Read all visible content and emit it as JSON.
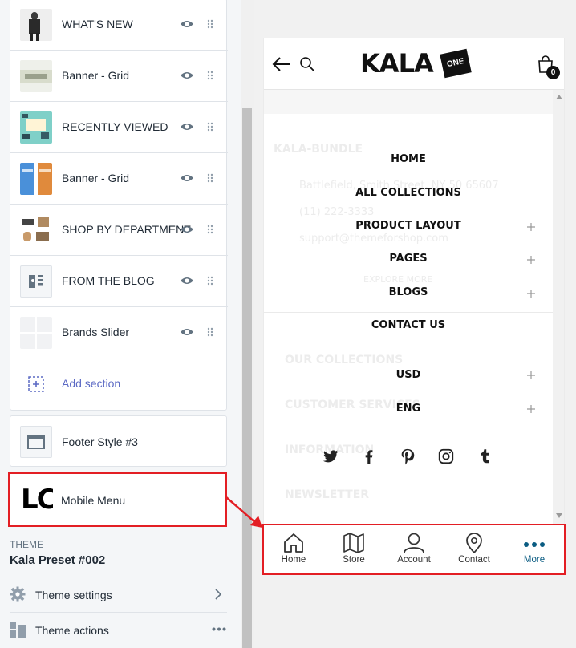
{
  "sections": [
    {
      "label": "WHAT'S NEW",
      "thumb": "photo-person-icon"
    },
    {
      "label": "Banner - Grid",
      "thumb": "photo-banner-icon"
    },
    {
      "label": "RECENTLY VIEWED",
      "thumb": "photo-summer-icon"
    },
    {
      "label": "Banner - Grid",
      "thumb": "photo-banner2-icon"
    },
    {
      "label": "SHOP BY DEPARTMENT",
      "thumb": "photo-furniture-icon"
    },
    {
      "label": "FROM THE BLOG",
      "thumb": "blog-icon"
    },
    {
      "label": "Brands Slider",
      "thumb": "grid-icon"
    }
  ],
  "add_section": "Add section",
  "footer_label": "Footer Style #3",
  "mobile_menu_label": "Mobile Menu",
  "mobile_menu_thumb_text": "LC",
  "theme": {
    "heading": "THEME",
    "name": "Kala Preset #002",
    "settings": "Theme settings",
    "actions": "Theme actions"
  },
  "preview": {
    "logo": "KALA",
    "logo_badge": "ONE",
    "cart_count": "0",
    "menu": [
      {
        "label": "HOME",
        "plus": false
      },
      {
        "label": "ALL COLLECTIONS",
        "plus": false
      },
      {
        "label": "PRODUCT LAYOUT",
        "plus": true
      },
      {
        "label": "PAGES",
        "plus": true
      },
      {
        "label": "BLOGS",
        "plus": true
      },
      {
        "label": "CONTACT US",
        "plus": false
      }
    ],
    "currency": "USD",
    "language": "ENG",
    "bg_brand": "KALA-BUNDLE",
    "bg_address": "Battlefield, Smith Street, NY 50 65607",
    "bg_phone": "(11) 222-3333",
    "bg_email": "support@themeforshop.com",
    "bg_link": "EXPLORE MORE",
    "bg_footer": [
      "OUR COLLECTIONS",
      "CUSTOMER SERVICES",
      "INFORMATION",
      "NEWSLETTER"
    ],
    "social": [
      "twitter-icon",
      "facebook-icon",
      "pinterest-icon",
      "instagram-icon",
      "tumblr-icon"
    ]
  },
  "bottom_nav": [
    {
      "label": "Home",
      "icon": "home-icon"
    },
    {
      "label": "Store",
      "icon": "map-icon"
    },
    {
      "label": "Account",
      "icon": "user-icon"
    },
    {
      "label": "Contact",
      "icon": "location-pin-icon"
    },
    {
      "label": "More",
      "icon": "more-dots-icon"
    }
  ],
  "colors": {
    "accent": "#5c6ac4",
    "highlight": "#e31e24",
    "more": "#0a5c82"
  }
}
